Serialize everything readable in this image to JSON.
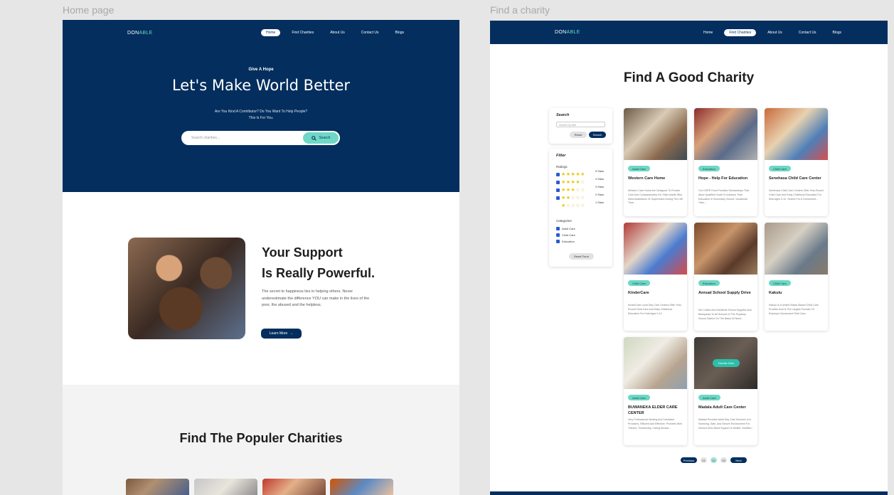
{
  "labels": {
    "home": "Home page",
    "find": "Find a charity"
  },
  "brand": {
    "prefix": "DON",
    "accent": "ABLE"
  },
  "nav": [
    "Home",
    "Find Charities",
    "About Us",
    "Contact Us",
    "Blogs"
  ],
  "home": {
    "kicker": "Give A Hope",
    "title": "Let's Make World Better",
    "subtitle_1": "Are You Kind A Contributor? Do You Want To Help People?",
    "subtitle_2": "This Is For You.",
    "search_placeholder": "Search charities...",
    "search_label": "Search",
    "support_line1": "Your Support",
    "support_line2": "Is Really Powerful.",
    "support_text": "The secret to happiness lies in helping others. Never underestimate the difference YOU can make in the lives of the poor, the abused and the helpless.",
    "learn_more": "Learn More",
    "popular_title": "Find The Populer Charities"
  },
  "find": {
    "title": "Find A Good Charity",
    "search_heading": "Search",
    "search_placeholder": "Search by title",
    "reset": "Reset",
    "search_btn": "Search",
    "filter_heading": "Filter",
    "ratings_label": "Ratings:",
    "ratings": [
      "5 Stars",
      "4 Stars",
      "3 Stars",
      "2 Stars",
      "1 Stars"
    ],
    "ratings_values": [
      5,
      4,
      3,
      2,
      1
    ],
    "categories_label": "Categories",
    "categories": [
      "Adult Care",
      "Child Care",
      "Education"
    ],
    "reset_form": "Reset Form",
    "donate_now": "Donate Now",
    "cards": [
      {
        "tag": "Adult Care",
        "name": "Western Care Home",
        "desc": "Western Care Home Are Designed To Provide Care And Companionship For Older Adults Who Need Assistance Or Supervision During The Life Time."
      },
      {
        "tag": "Education",
        "name": "Hope - Help For Education",
        "desc": "Our HOPE Fund Provides Scholarships That Allow Qualified Youth To Advance Their Education In Secondary School, Vocational Train..."
      },
      {
        "tag": "Child Care",
        "name": "Senehasa Child Care Center",
        "desc": "Senehasa Child Care Centers Offer Year-Round Child Care And Early Childhood Education For Kids Ages 0-12. Search For A Convenient..."
      },
      {
        "tag": "Child Care",
        "name": "KinderCare",
        "desc": "KinderCare Local Day Care Centers Offer Year-Round Child Care And Early Childhood Education For Kids Ages 0-12."
      },
      {
        "tag": "Education",
        "name": "Annual School Supply Drive",
        "desc": "We Collect And Distribute School Supplies And Backpacks To All Schools In The Puyallup School District On The Basis Of Need..."
      },
      {
        "tag": "Child Care",
        "name": "Kakulu",
        "desc": "Kakulu Is A United States-Based Child-Care Provider And Is The Largest Provider Of Employer-Sponsored Child Care."
      },
      {
        "tag": "Adult Care",
        "name": "BUWANEKA ELDER CARE CENTER",
        "desc": "Very Professional Nursing And Caretaker Providers, Efficient And Effective. Provides Well Trained, Trustworthy, Caring Nurses..."
      },
      {
        "tag": "Adult Care",
        "name": "Madala Adult Care Center",
        "desc": "Madala Provides Adult Day Care Services In A Nurturing, Safe, And Secure Environment For Seniors Who Need Support In Health, Nutrition..."
      }
    ],
    "pager": {
      "prev": "Previous",
      "pages": [
        "01",
        "02",
        "03"
      ],
      "next": "Next"
    }
  }
}
